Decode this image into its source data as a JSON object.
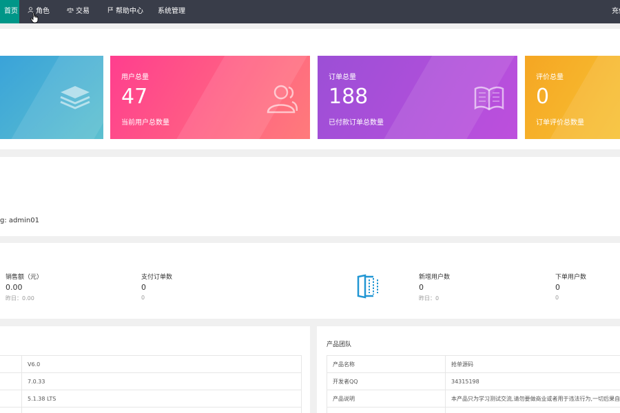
{
  "nav": {
    "items": [
      {
        "label": "首页",
        "icon": "home-icon"
      },
      {
        "label": "角色",
        "icon": "user-icon"
      },
      {
        "label": "交易",
        "icon": "scale-icon"
      },
      {
        "label": "帮助中心",
        "icon": "flag-icon"
      },
      {
        "label": "系统管理",
        "icon": ""
      }
    ],
    "right_label": "充值"
  },
  "cards": [
    {
      "title": "",
      "value": "",
      "desc": "",
      "icon": "layers-icon",
      "color": "#3aa3d9"
    },
    {
      "title": "用户总量",
      "value": "47",
      "desc": "当前用户总数量",
      "icon": "users-icon",
      "color": "#ff3e8e"
    },
    {
      "title": "订单总量",
      "value": "188",
      "desc": "已付款订单总数量",
      "icon": "book-icon",
      "color": "#9c4fd6"
    },
    {
      "title": "评价总量",
      "value": "0",
      "desc": "订单评价总数量",
      "icon": "",
      "color": "#f5a623"
    }
  ],
  "welcome": {
    "login_info": "g: admin01"
  },
  "stats": [
    {
      "label": "销售额（元）",
      "value": "0.00",
      "sub": "昨日：0.00"
    },
    {
      "label": "支付订单数",
      "value": "0",
      "sub": "0"
    },
    {
      "label": "新增用户数",
      "value": "0",
      "sub": "昨日：0"
    },
    {
      "label": "下单用户数",
      "value": "0",
      "sub": "0"
    }
  ],
  "system": {
    "rows": [
      {
        "value": "V6.0"
      },
      {
        "value": "7.0.33"
      },
      {
        "value": "5.1.38 LTS"
      }
    ]
  },
  "team": {
    "title": "产品团队",
    "rows": [
      {
        "key": "产品名称",
        "value": "抢单源码"
      },
      {
        "key": "开发者QQ",
        "value": "34315198"
      },
      {
        "key": "产品说明",
        "value": "本产品只为学习测试交流,请勿要做商业或者用于违法行为,一切后果自负"
      }
    ]
  }
}
